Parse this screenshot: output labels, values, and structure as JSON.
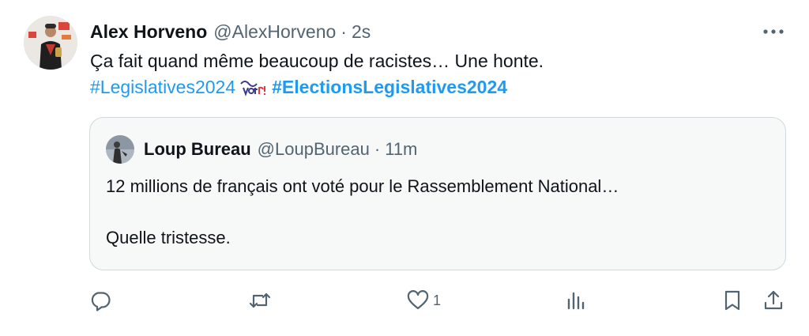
{
  "tweet": {
    "author_name": "Alex Horveno",
    "handle": "@AlexHorveno",
    "separator": "·",
    "time": "2s",
    "line1": "Ça fait quand même beaucoup de racistes… Une honte.",
    "hashtag1": "#Legislatives2024",
    "hashtag2": "#ElectionsLegislatives2024"
  },
  "quote": {
    "author_name": "Loup Bureau",
    "handle": "@LoupBureau",
    "separator": "·",
    "time": "11m",
    "line1": "12 millions de français ont voté pour le Rassemblement National…",
    "line2": "Quelle tristesse."
  },
  "actions": {
    "reply_icon": "reply-icon",
    "retweet_icon": "retweet-icon",
    "like_icon": "heart-icon",
    "like_count": "1",
    "views_icon": "views-chart-icon",
    "bookmark_icon": "bookmark-icon",
    "share_icon": "share-icon"
  },
  "colors": {
    "link": "#1d9bf0",
    "secondary_text": "#536471",
    "primary_text": "#0f1419",
    "quote_border": "#cfd9de"
  }
}
